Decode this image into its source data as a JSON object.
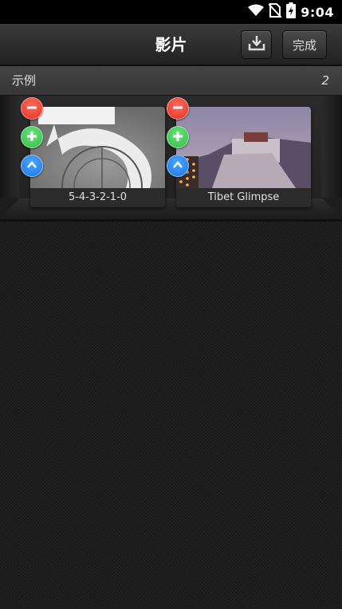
{
  "status_bar": {
    "time": "9:04",
    "icons": [
      "wifi-icon",
      "no-sim-icon",
      "battery-charging-icon"
    ]
  },
  "header": {
    "title": "影片",
    "download_icon": "download-icon",
    "done_label": "完成"
  },
  "section": {
    "title": "示例",
    "count": "2"
  },
  "videos": [
    {
      "title": "5-4-3-2-1-0"
    },
    {
      "title": "Tibet Glimpse"
    }
  ],
  "colors": {
    "delete": "#e23224",
    "add": "#2fbd45",
    "move": "#1976e6",
    "header_bg": "#2b2b2b",
    "section_bg": "#3d3d3d"
  }
}
